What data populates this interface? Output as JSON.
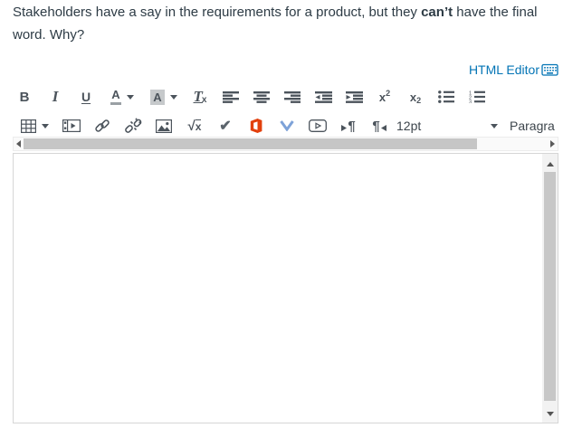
{
  "question": {
    "text_before_bold": "Stakeholders have a say in the requirements for a product, but they ",
    "bold_text": "can’t",
    "text_after_bold": " have the final word. Why?"
  },
  "editor": {
    "html_editor_link": "HTML Editor",
    "toolbar": {
      "row1": [
        {
          "name": "bold",
          "glyph": "B"
        },
        {
          "name": "italic",
          "glyph": "I"
        },
        {
          "name": "underline",
          "glyph": "U"
        },
        {
          "name": "text-color",
          "glyph": "A"
        },
        {
          "name": "background-color",
          "glyph": "A"
        },
        {
          "name": "clear-formatting",
          "glyph": "T",
          "sub": "x"
        },
        {
          "name": "align-left"
        },
        {
          "name": "align-center"
        },
        {
          "name": "align-right"
        },
        {
          "name": "outdent"
        },
        {
          "name": "indent"
        },
        {
          "name": "superscript",
          "glyph": "x",
          "script": "2"
        },
        {
          "name": "subscript",
          "glyph": "x",
          "script": "2"
        },
        {
          "name": "bullet-list"
        },
        {
          "name": "numbered-list"
        }
      ],
      "row2": [
        {
          "name": "table"
        },
        {
          "name": "record-media"
        },
        {
          "name": "link"
        },
        {
          "name": "unlink"
        },
        {
          "name": "image"
        },
        {
          "name": "equation",
          "glyph": "√",
          "sub": "x"
        },
        {
          "name": "external-tool-check",
          "glyph": "✔"
        },
        {
          "name": "office365"
        },
        {
          "name": "v-tool"
        },
        {
          "name": "video-embed"
        },
        {
          "name": "left-to-right-paragraph",
          "glyph": "¶"
        },
        {
          "name": "right-to-left-paragraph",
          "glyph": "¶"
        }
      ],
      "font_size": "12pt",
      "paragraph_format": "Paragra"
    },
    "colors": {
      "link_blue": "#0374b5",
      "icon_gray": "#4c545c",
      "office_orange": "#e2400d",
      "v_tool_blue": "#7da2d8",
      "question_text": "#2d3b45"
    }
  }
}
